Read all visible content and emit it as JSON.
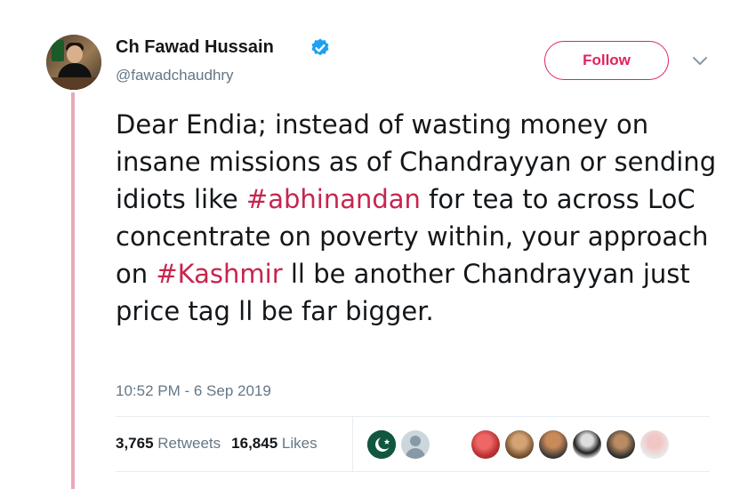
{
  "user": {
    "display_name": "Ch Fawad Hussain",
    "handle": "@fawadchaudhry",
    "verified": true
  },
  "follow_button": {
    "label": "Follow"
  },
  "tweet": {
    "text_parts": [
      "Dear Endia; instead of wasting money on insane missions as of Chandrayyan or sending idiots like ",
      "#abhinandan",
      " for tea to across LoC concentrate on poverty within, your approach on ",
      "#Kashmir",
      " ll be another Chandrayyan just price tag ll be far bigger."
    ],
    "timestamp": "10:52 PM - 6 Sep 2019"
  },
  "stats": {
    "retweets_count": "3,765",
    "retweets_label": "Retweets",
    "likes_count": "16,845",
    "likes_label": "Likes"
  },
  "colors": {
    "accent": "#e0245e",
    "hashtag": "#c7254e",
    "verified": "#1da1f2",
    "secondary_text": "#657786",
    "thread_line": "#e8a9b6"
  }
}
